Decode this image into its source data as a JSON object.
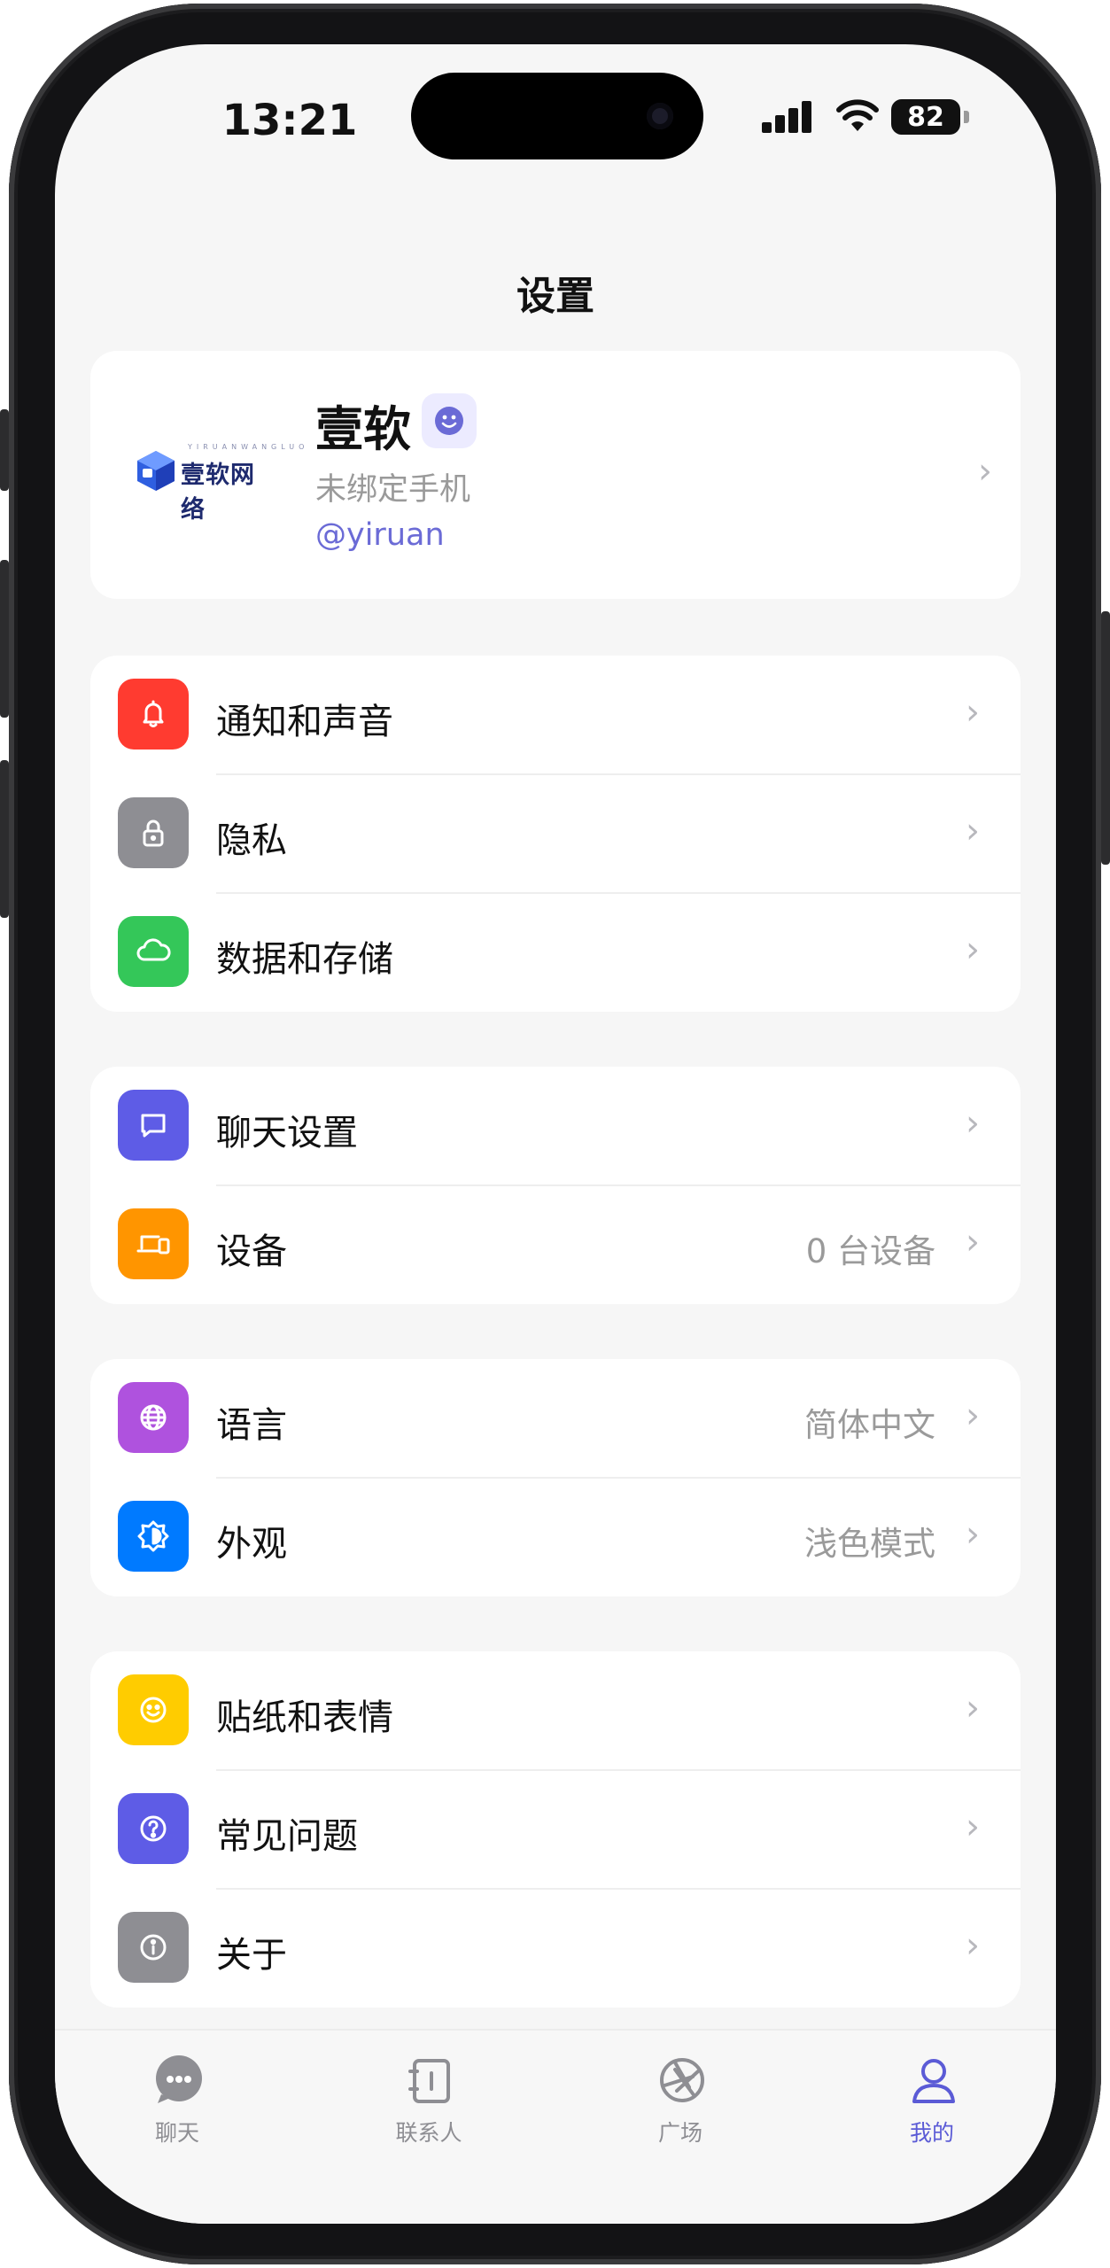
{
  "status_bar": {
    "time": "13:21",
    "battery": "82"
  },
  "header": {
    "title": "设置"
  },
  "profile": {
    "logo_text": "壹软网络",
    "logo_sub": "YIRUANWANGLUO",
    "name": "壹软",
    "phone": "未绑定手机",
    "handle": "@yiruan"
  },
  "groups": [
    {
      "items": [
        {
          "label": "通知和声音",
          "value": "",
          "icon": "bell-icon",
          "color": "#ff3b30"
        },
        {
          "label": "隐私",
          "value": "",
          "icon": "lock-icon",
          "color": "#8e8e93"
        },
        {
          "label": "数据和存储",
          "value": "",
          "icon": "cloud-icon",
          "color": "#34c759"
        }
      ]
    },
    {
      "items": [
        {
          "label": "聊天设置",
          "value": "",
          "icon": "chat-bubble-icon",
          "color": "#5e5ce6"
        },
        {
          "label": "设备",
          "value": "0 台设备",
          "icon": "devices-icon",
          "color": "#ff9500"
        }
      ]
    },
    {
      "items": [
        {
          "label": "语言",
          "value": "简体中文",
          "icon": "globe-icon",
          "color": "#af52de"
        },
        {
          "label": "外观",
          "value": "浅色模式",
          "icon": "appearance-icon",
          "color": "#007aff"
        }
      ]
    },
    {
      "items": [
        {
          "label": "贴纸和表情",
          "value": "",
          "icon": "smiley-icon",
          "color": "#ffcc00"
        },
        {
          "label": "常见问题",
          "value": "",
          "icon": "question-icon",
          "color": "#5e5ce6"
        },
        {
          "label": "关于",
          "value": "",
          "icon": "info-icon",
          "color": "#8e8e93"
        }
      ]
    }
  ],
  "tabbar": {
    "tabs": [
      {
        "label": "聊天",
        "icon": "chat-tab-icon"
      },
      {
        "label": "联系人",
        "icon": "contacts-tab-icon"
      },
      {
        "label": "广场",
        "icon": "aperture-tab-icon"
      },
      {
        "label": "我的",
        "icon": "person-tab-icon"
      }
    ],
    "active_index": 3,
    "active_color": "#5b5bd6"
  }
}
